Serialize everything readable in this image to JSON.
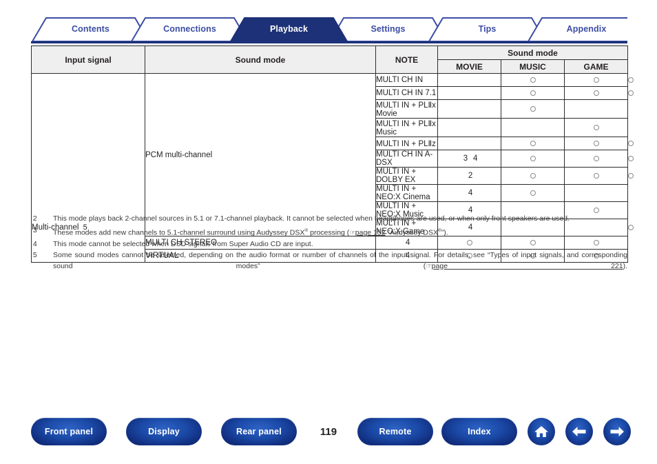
{
  "tabs": [
    {
      "label": "Contents",
      "active": false
    },
    {
      "label": "Connections",
      "active": false
    },
    {
      "label": "Playback",
      "active": true
    },
    {
      "label": "Settings",
      "active": false
    },
    {
      "label": "Tips",
      "active": false
    },
    {
      "label": "Appendix",
      "active": false
    }
  ],
  "table": {
    "headers": {
      "input_signal": "Input signal",
      "sound_mode": "Sound mode",
      "note": "NOTE",
      "sound_mode_group": "Sound mode",
      "movie": "MOVIE",
      "music": "MUSIC",
      "game": "GAME"
    },
    "category": "Multi-channel",
    "category_note": " 5",
    "subcategory": "PCM multi-channel",
    "rows": [
      {
        "mode": "MULTI CH IN",
        "note": "",
        "movie": true,
        "music": true,
        "game": true
      },
      {
        "mode": "MULTI CH IN 7.1",
        "note": "",
        "movie": true,
        "music": true,
        "game": true
      },
      {
        "mode": "MULTI IN + PLⅡx Movie",
        "note": "",
        "movie": true,
        "music": false,
        "game": false
      },
      {
        "mode": "MULTI IN + PLⅡx Music",
        "note": "",
        "movie": false,
        "music": true,
        "game": false
      },
      {
        "mode": "MULTI IN + PLⅡz",
        "note": "",
        "movie": true,
        "music": true,
        "game": true
      },
      {
        "mode": "MULTI CH IN A-DSX",
        "note": " 3  4",
        "movie": true,
        "music": true,
        "game": true
      },
      {
        "mode": "MULTI IN + DOLBY EX",
        "note": " 2",
        "movie": true,
        "music": true,
        "game": true
      },
      {
        "mode": "MULTI IN + NEO:X Cinema",
        "note": " 4",
        "movie": true,
        "music": false,
        "game": false
      },
      {
        "mode": "MULTI IN + NEO:X Music",
        "note": " 4",
        "movie": false,
        "music": true,
        "game": false
      },
      {
        "mode": "MULTI IN + NEO:X Game",
        "note": " 4",
        "movie": false,
        "music": false,
        "game": true
      },
      {
        "mode": "MULTI CH STEREO",
        "note": " 4",
        "movie": true,
        "music": true,
        "game": true
      },
      {
        "mode": "VIRTUAL",
        "note": " 4",
        "movie": true,
        "music": true,
        "game": true
      }
    ]
  },
  "footnotes": [
    {
      "key": " 2",
      "text": "This mode plays back 2-channel sources in 5.1 or 7.1-channel playback. It cannot be selected when headphones are used, or when only front speakers are used."
    },
    {
      "key": " 3",
      "pre": "These modes add new channels to 5.1-channel surround using Audyssey DSX",
      "sup1": "®",
      "mid": " processing (",
      "link": "page 152",
      "post": " ”Audyssey DSX",
      "sup2": "®",
      "tail": "”)."
    },
    {
      "key": " 4",
      "text": "This mode cannot be selected when DSD signals from Super Audio CD are input."
    },
    {
      "key": " 5",
      "pre": "Some sound modes cannot be selected, depending on the audio format or number of channels of the input signal. For details, see “Types of input signals, and corresponding sound modes” (",
      "link": "page 221",
      "tail": ")."
    }
  ],
  "bottom_nav": {
    "buttons": [
      {
        "label": "Front panel"
      },
      {
        "label": "Display"
      },
      {
        "label": "Rear panel"
      },
      {
        "label": "Remote"
      },
      {
        "label": "Index"
      }
    ],
    "page_number": "119",
    "icons": [
      "home-icon",
      "arrow-left-icon",
      "arrow-right-icon"
    ]
  },
  "colors": {
    "brand_blue": "#1d3178",
    "tab_text": "#3b4da4",
    "header_fill": "#efefef"
  }
}
